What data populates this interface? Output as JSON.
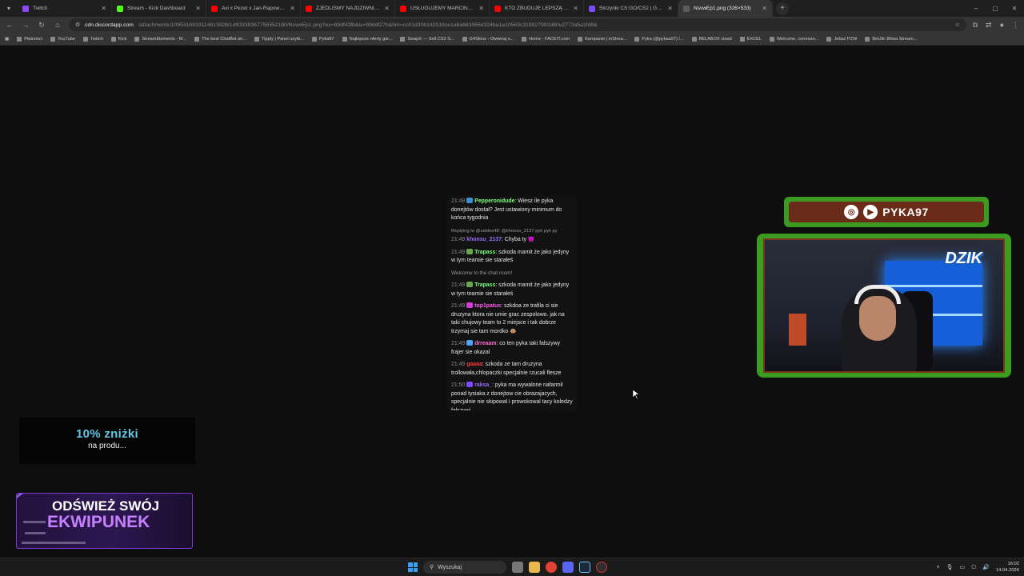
{
  "browser": {
    "tabs": [
      {
        "label": "Twitch",
        "color": "#9146ff",
        "active": false
      },
      {
        "label": "Stream - Kick Dashboard",
        "color": "#53fc18",
        "active": false
      },
      {
        "label": "Avi x Pezet x Jan-Rapowanie",
        "color": "#ff0000",
        "active": false
      },
      {
        "label": "ZJEDLIŚMY NAJDZIWNIEJSZA",
        "color": "#ff0000",
        "active": false
      },
      {
        "label": "USŁUGUJEMY MARCINOWI NA",
        "color": "#ff0000",
        "active": false
      },
      {
        "label": "KTO ZBUDUJE LEPSZĄ RZECZ -",
        "color": "#ff0000",
        "active": false
      },
      {
        "label": "Skrzynki CS:GO/CS2 | G4Skins",
        "color": "#7b49ff",
        "active": false
      },
      {
        "label": "NsvwEp1.png (326×533)",
        "color": "#5b5b5b",
        "active": true
      }
    ],
    "address": {
      "domain": "cdn.discordapp.com",
      "path": "/attachments/1095316933114613828/1493338367759352160/NsvwEp1.png?ex=69df43fb&is=69ddf27b&hm=cc01d30b1d2518ce1a6a663065d324ba1a10563c319927992d80e2773a5a1fd6&"
    },
    "bookmarks": [
      "Płatności",
      "YouTube",
      "Twitch",
      "Kick",
      "StreamElements - M...",
      "The best ChatBot an...",
      "Tipply | Panel użytk...",
      "Pyka97",
      "Najlepsze oferty gie...",
      "SwapX — Sell CS2 S...",
      "G4Skins - Otwieraj s...",
      "Home - FACEIT.com",
      "Kampanie | inStrea...",
      "Pyka (@pykaa97) /...",
      "BELABOX cloud",
      "EXCEL",
      "Welcome, comman...",
      "Jebać PZW",
      "BetJilc Bitwa Stream..."
    ]
  },
  "chat": {
    "messages": [
      {
        "time": "21:49",
        "user": "Pepperonidude",
        "user_color": "#7dff7d",
        "badge_color": "#3a8ed6",
        "text": ": Wiesz ile pyka donejtów dostał? Jest ustawiony minimum do końca tygodnia"
      },
      {
        "reply": "Replying to @sables48: @khonsu_2137 pyk pyk py",
        "time": "21:49",
        "user": "khonsu_2137",
        "user_color": "#9b6bff",
        "text": ": Chyba ty 😈"
      },
      {
        "time": "21:49",
        "user": "Trapass",
        "user_color": "#7dff7d",
        "badge_color": "#6aa84f",
        "text": ": szkoda mamit że jako jedyny w tym teamie sie starałeś"
      },
      {
        "system": "Welcome to the chat room!"
      },
      {
        "time": "21:49",
        "user": "Trapass",
        "user_color": "#7dff7d",
        "badge_color": "#6aa84f",
        "text": ": szkoda mamit że jako jedyny w tym teamie sie starałeś"
      },
      {
        "time": "21:49",
        "user": "top1patus",
        "user_color": "#ff5cf2",
        "badge_color": "#d63bd6",
        "text": ": szkdoa ze trafila ci sie druzyna ktora nie umie grac zespolowo. jak na taki chujowy team to 2 miejsce i tak dobrze trzymaj sie tam mordko 🐵"
      },
      {
        "time": "21:49",
        "user": "drreaam",
        "user_color": "#ff6ad5",
        "badge_color": "#4fa3ff",
        "text": ": co ten pyka taki falszywy frajer sie okazal"
      },
      {
        "time": "21:49",
        "user": "gaaaa",
        "user_color": "#ff3b3b",
        "text": ": szkoda ze tam druzyna trollowała,chlopaczki specjalnie rzucali flesze"
      },
      {
        "time": "21:50",
        "user": "raksa_",
        "user_color": "#9b6bff",
        "badge_color": "#7b49ff",
        "text": ": pyka ma wywalone nafarmil ponad tysiaka z donejtow cie obrazajacych, specjalnie nie skipowal i prowokowal tacy koledzy falszywi"
      }
    ]
  },
  "promo": {
    "line1": "10% zniżki",
    "line2": "na produ..."
  },
  "equipment": {
    "line1": "ODŚWIEŻ SWÓJ",
    "line2": "EKWIPUNEK"
  },
  "streamer": {
    "name": "PYKA97"
  },
  "webcam": {
    "logo": "DZIK"
  },
  "taskbar": {
    "search_placeholder": "Wyszukaj",
    "time": "16:02",
    "date": "14.04.2026"
  }
}
